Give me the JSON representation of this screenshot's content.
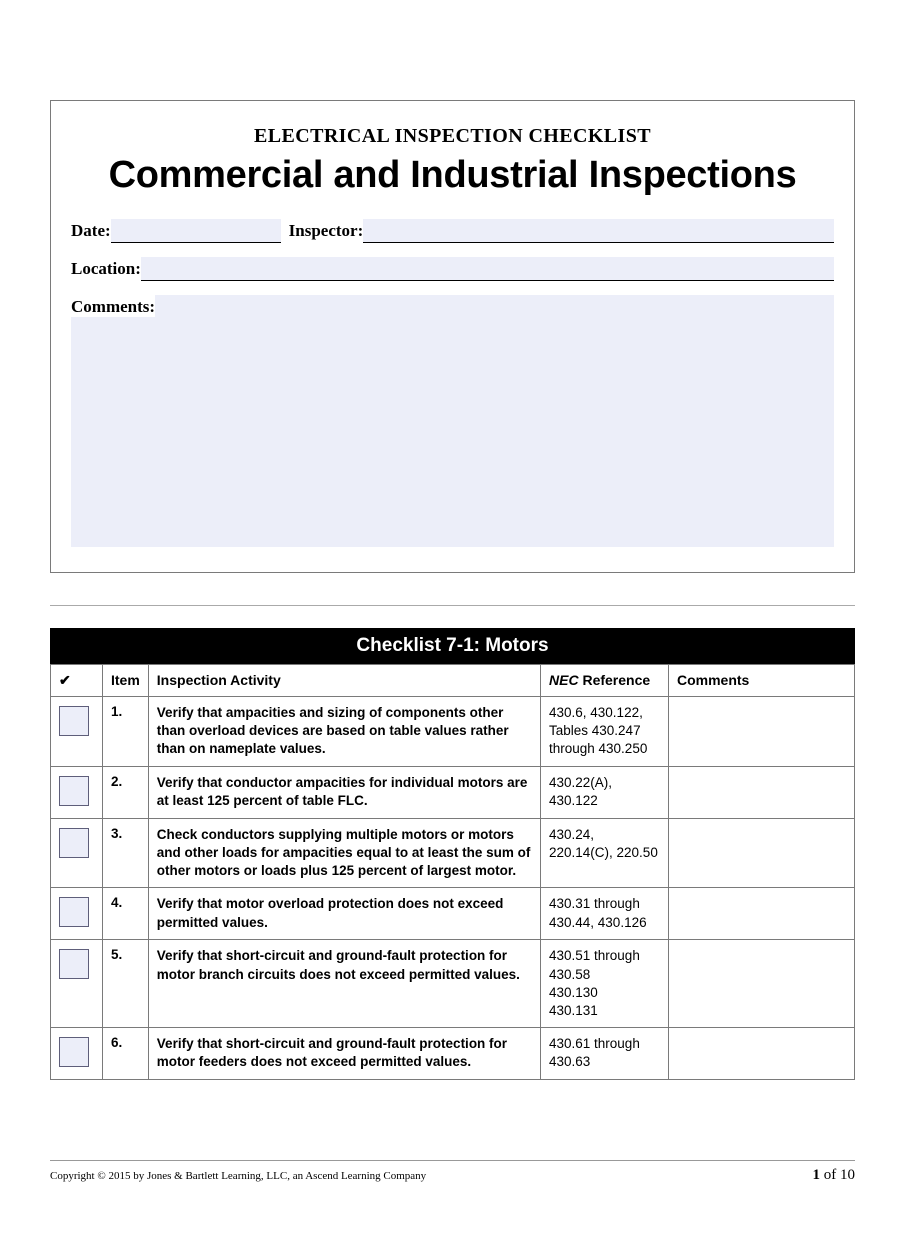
{
  "header": {
    "overline": "ELECTRICAL INSPECTION CHECKLIST",
    "title": "Commercial and Industrial Inspections"
  },
  "fields": {
    "date_label": "Date:",
    "date_value": "",
    "inspector_label": "Inspector:",
    "inspector_value": "",
    "location_label": "Location:",
    "location_value": "",
    "comments_label": "Comments:",
    "comments_value": ""
  },
  "checklist": {
    "title": "Checklist 7-1: Motors",
    "columns": {
      "check": "✔",
      "item": "Item",
      "activity": "Inspection Activity",
      "nec_italic": "NEC",
      "nec_rest": " Reference",
      "comments": "Comments"
    },
    "rows": [
      {
        "item": "1.",
        "activity": "Verify that ampacities and sizing of components other than overload devices are based on table values rather than on nameplate values.",
        "nec": "430.6, 430.122, Tables 430.247 through 430.250",
        "comments": ""
      },
      {
        "item": "2.",
        "activity": "Verify that conductor ampacities for individual motors are at least 125 percent of table FLC.",
        "nec": "430.22(A), 430.122",
        "comments": ""
      },
      {
        "item": "3.",
        "activity": "Check conductors supplying multiple motors or motors and other loads for ampacities equal to at least the sum of other motors or loads plus 125 percent of largest motor.",
        "nec": "430.24, 220.14(C), 220.50",
        "comments": ""
      },
      {
        "item": "4.",
        "activity": "Verify that motor overload protection does not exceed permitted values.",
        "nec": "430.31 through 430.44, 430.126",
        "comments": ""
      },
      {
        "item": "5.",
        "activity": "Verify that short-circuit and ground-fault protection for motor branch circuits does not exceed permitted values.",
        "nec": "430.51 through 430.58\n430.130\n430.131",
        "comments": ""
      },
      {
        "item": "6.",
        "activity": "Verify that short-circuit and ground-fault protection for motor feeders does not exceed permitted values.",
        "nec": "430.61 through 430.63",
        "comments": ""
      }
    ]
  },
  "footer": {
    "copyright": "Copyright © 2015 by Jones & Bartlett Learning, LLC, an Ascend Learning Company",
    "page_current": "1",
    "page_sep": " of ",
    "page_total": "10"
  }
}
